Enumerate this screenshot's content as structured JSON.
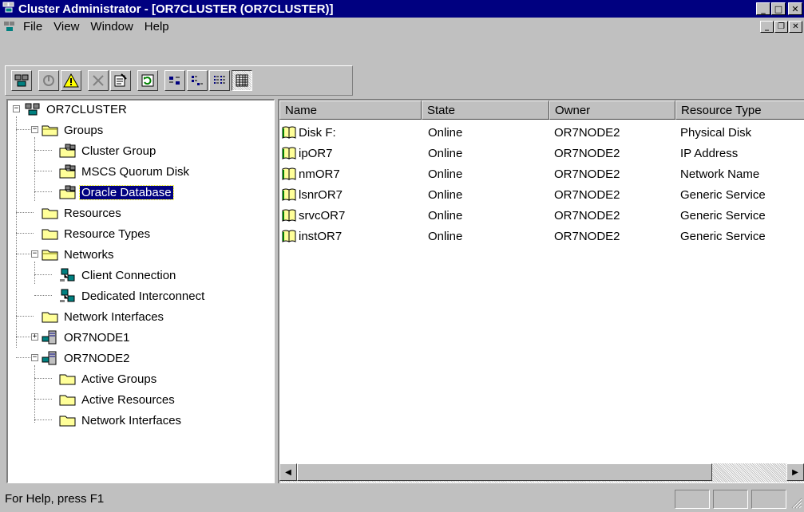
{
  "window": {
    "title": "Cluster Administrator - [OR7CLUSTER (OR7CLUSTER)]",
    "minimize": "_",
    "maximize": "□",
    "close": "✕"
  },
  "menu": {
    "file": "File",
    "view": "View",
    "window": "Window",
    "help": "Help",
    "mdi_minimize": "_",
    "mdi_restore": "❐",
    "mdi_close": "✕"
  },
  "toolbar": {
    "buttons": [
      {
        "name": "open-connection-icon"
      },
      {
        "name": "bring-online-icon"
      },
      {
        "name": "take-offline-icon"
      },
      {
        "name": "delete-icon"
      },
      {
        "name": "properties-icon"
      },
      {
        "name": "refresh-icon"
      },
      {
        "name": "large-icons-view-icon"
      },
      {
        "name": "small-icons-view-icon"
      },
      {
        "name": "list-view-icon"
      },
      {
        "name": "details-view-icon"
      }
    ]
  },
  "tree": {
    "root": "OR7CLUSTER",
    "groups": "Groups",
    "cluster_group": "Cluster Group",
    "mscs_quorum": "MSCS Quorum Disk",
    "oracle_db": "Oracle Database",
    "resources": "Resources",
    "resource_types": "Resource Types",
    "networks": "Networks",
    "client_connection": "Client Connection",
    "dedicated_interconnect": "Dedicated Interconnect",
    "network_interfaces": "Network Interfaces",
    "node1": "OR7NODE1",
    "node2": "OR7NODE2",
    "active_groups": "Active Groups",
    "active_resources": "Active Resources",
    "node2_network_interfaces": "Network Interfaces"
  },
  "list": {
    "columns": [
      "Name",
      "State",
      "Owner",
      "Resource Type"
    ],
    "rows": [
      [
        "Disk F:",
        "Online",
        "OR7NODE2",
        "Physical Disk"
      ],
      [
        "ipOR7",
        "Online",
        "OR7NODE2",
        "IP Address"
      ],
      [
        "nmOR7",
        "Online",
        "OR7NODE2",
        "Network Name"
      ],
      [
        "lsnrOR7",
        "Online",
        "OR7NODE2",
        "Generic Service"
      ],
      [
        "srvcOR7",
        "Online",
        "OR7NODE2",
        "Generic Service"
      ],
      [
        "instOR7",
        "Online",
        "OR7NODE2",
        "Generic Service"
      ]
    ]
  },
  "scroll": {
    "left_arrow": "◀",
    "right_arrow": "▶"
  },
  "status": {
    "text": "For Help, press F1"
  }
}
